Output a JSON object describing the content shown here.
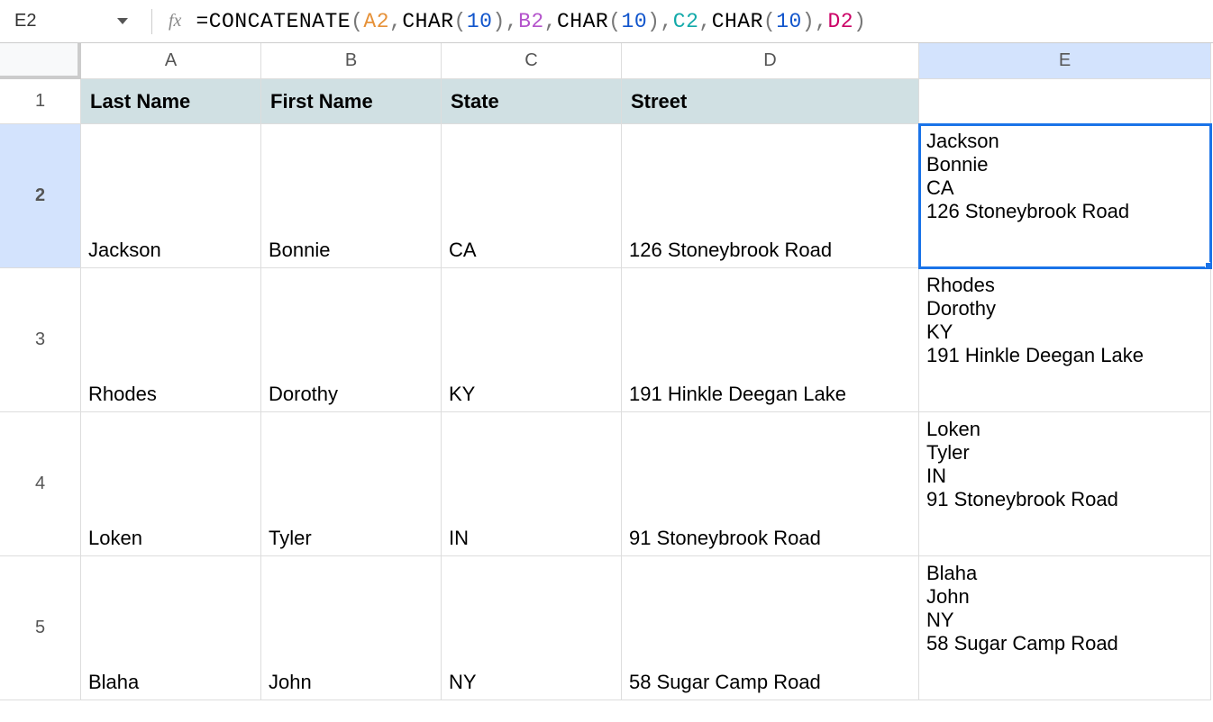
{
  "nameBox": "E2",
  "formula": {
    "eq": "=",
    "func": "CONCATENATE",
    "open": "(",
    "ref1": "A2",
    "comma": ",",
    "char": "CHAR",
    "chOpen": "(",
    "ten": "10",
    "chClose": ")",
    "ref2": "B2",
    "ref3": "C2",
    "ref4": "D2",
    "close": ")"
  },
  "columns": [
    "A",
    "B",
    "C",
    "D",
    "E"
  ],
  "rowNums": [
    "1",
    "2",
    "3",
    "4",
    "5"
  ],
  "headers": {
    "lastName": "Last Name",
    "firstName": "First Name",
    "state": "State",
    "street": "Street"
  },
  "rows": [
    {
      "last": "Jackson",
      "first": "Bonnie",
      "state": "CA",
      "street": "126 Stoneybrook Road",
      "e": "Jackson\nBonnie\nCA\n126 Stoneybrook Road"
    },
    {
      "last": "Rhodes",
      "first": "Dorothy",
      "state": "KY",
      "street": "191 Hinkle Deegan Lake",
      "e": "Rhodes\nDorothy\nKY\n191 Hinkle Deegan Lake"
    },
    {
      "last": "Loken",
      "first": "Tyler",
      "state": "IN",
      "street": "91 Stoneybrook Road",
      "e": "Loken\nTyler\nIN\n91 Stoneybrook Road"
    },
    {
      "last": "Blaha",
      "first": "John",
      "state": "NY",
      "street": "58 Sugar Camp Road",
      "e": "Blaha\nJohn\nNY\n58 Sugar Camp Road"
    }
  ]
}
